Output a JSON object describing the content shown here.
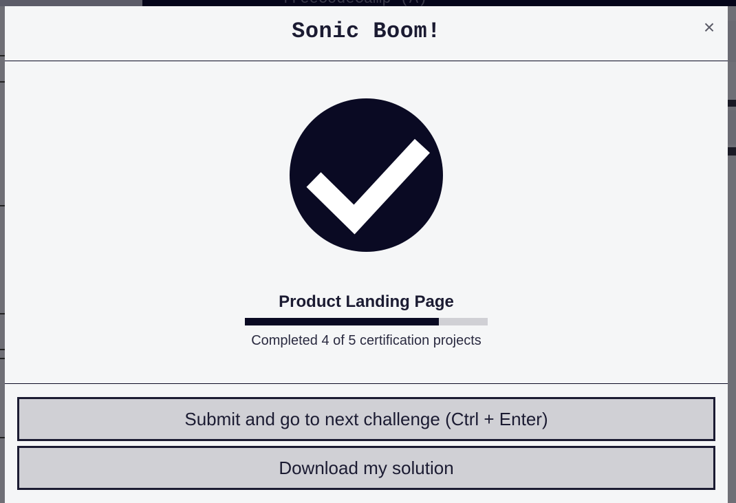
{
  "background": {
    "top_title": "freeCodeCamp (A)"
  },
  "modal": {
    "title": "Sonic Boom!",
    "close_symbol": "×",
    "icon": "check-circle-icon",
    "project_name": "Product Landing Page",
    "progress": {
      "completed": 4,
      "total": 5,
      "fraction": 0.8,
      "text": "Completed 4 of 5 certification projects"
    },
    "submit_label": "Submit and go to next challenge (Ctrl + Enter)",
    "download_label": "Download my solution"
  },
  "colors": {
    "dark": "#0a0a23",
    "panel": "#f5f6f7",
    "button": "#d0d0d5"
  }
}
